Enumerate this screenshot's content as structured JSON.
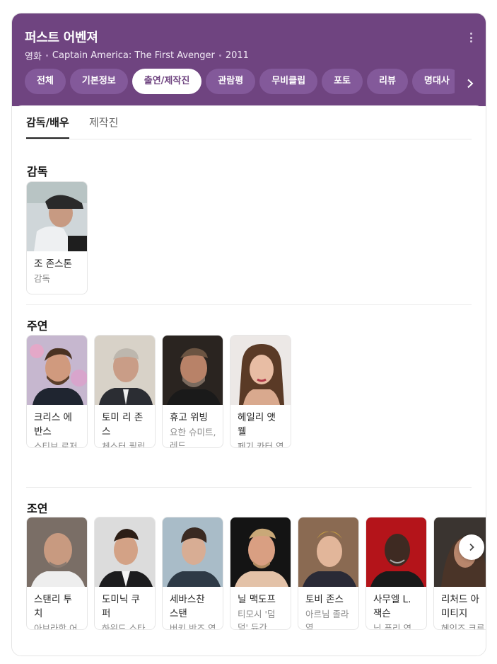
{
  "header": {
    "title": "퍼스트 어벤져",
    "meta": [
      "영화",
      "Captain America: The First Avenger",
      "2011"
    ],
    "tabs": [
      "전체",
      "기본정보",
      "출연/제작진",
      "관람평",
      "무비클립",
      "포토",
      "리뷰",
      "명대사"
    ],
    "active_tab": "출연/제작진",
    "more_icon": "more-vertical-icon",
    "next_icon": "chevron-right-icon"
  },
  "subtabs": [
    "감독/배우",
    "제작진"
  ],
  "sections": {
    "director": {
      "title": "감독",
      "people": [
        {
          "name": "조 존스톤",
          "role": "감독"
        }
      ]
    },
    "lead": {
      "title": "주연",
      "people": [
        {
          "name": "크리스 에반스",
          "role": "스티브 로저스, 캡..."
        },
        {
          "name": "토미 리 존스",
          "role": "체스터 필립스 역"
        },
        {
          "name": "휴고 위빙",
          "role": "요한 슈미트, 레드..."
        },
        {
          "name": "헤일리 앳웰",
          "role": "페기 카터 역"
        }
      ]
    },
    "supporting": {
      "title": "조연",
      "people": [
        {
          "name": "스탠리 투치",
          "role": "아브라함 어스킨 역"
        },
        {
          "name": "도미닉 쿠퍼",
          "role": "하워드 스타크 역"
        },
        {
          "name": "세바스찬 스탠",
          "role": "버키 반즈 역"
        },
        {
          "name": "닐 맥도프",
          "role": "티모시 '덤덤' 듀간..."
        },
        {
          "name": "토비 존스",
          "role": "아르님 졸라 역"
        },
        {
          "name": "사무엘 L. 잭슨",
          "role": "닉 퓨리 역"
        },
        {
          "name": "리처드 아미티지",
          "role": "헤인즈 크루거 역"
        }
      ]
    }
  },
  "colors": {
    "brand": "#6f4480",
    "tab_bg": "#83599a"
  }
}
